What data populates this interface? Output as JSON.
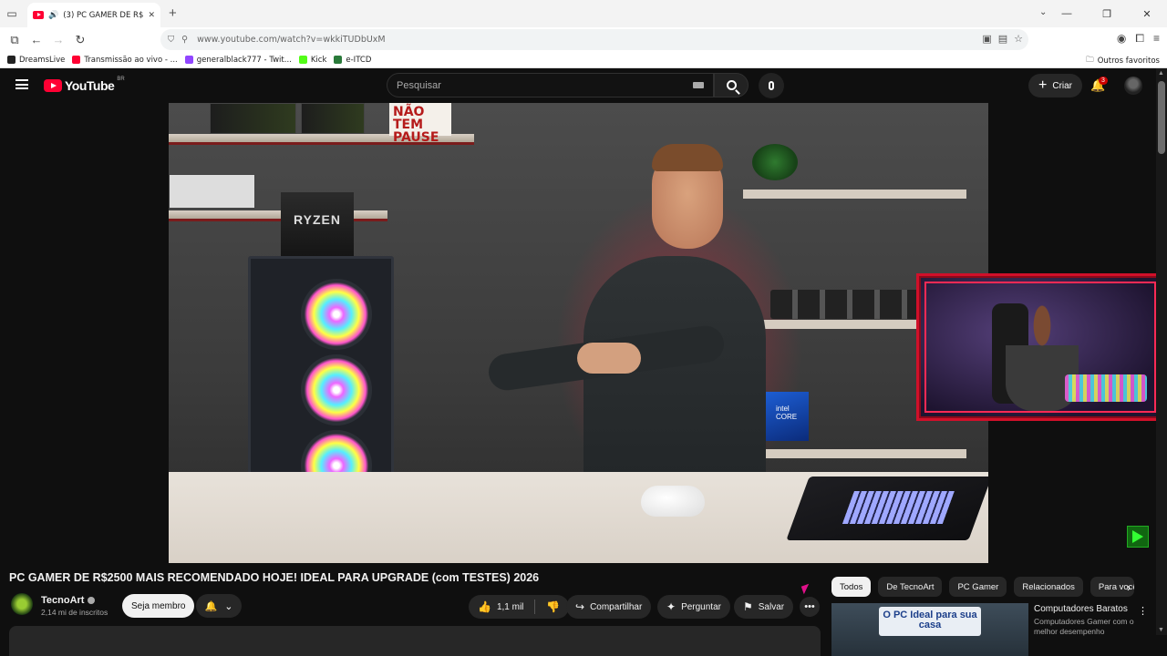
{
  "browser": {
    "tab_title": "(3) PC GAMER DE R$2500 M",
    "url": "www.youtube.com/watch?v=wkkiTUDbUxM",
    "bookmarks": [
      "DreamsLive",
      "Transmissão ao vivo - ...",
      "generalblack777 - Twit...",
      "Kick",
      "e-ITCD"
    ],
    "bookmarks_other": "Outros favoritos"
  },
  "youtube": {
    "logo_text": "YouTube",
    "region": "BR",
    "search_placeholder": "Pesquisar",
    "create_label": "Criar",
    "notification_count": "3"
  },
  "video": {
    "title": "PC GAMER DE R$2500 MAIS RECOMENDADO HOJE! IDEAL PARA UPGRADE (com TESTES) 2026",
    "overlay_sign": "NÃO TEM PAUSE",
    "ryzen_label": "RYZEN",
    "intel_label": "intel CORE"
  },
  "channel": {
    "name": "TecnoArt",
    "subscribers": "2,14 mi de inscritos",
    "member_button": "Seja membro"
  },
  "actions": {
    "likes": "1,1 mil",
    "share": "Compartilhar",
    "ask": "Perguntar",
    "save": "Salvar"
  },
  "filters": [
    "Todos",
    "De TecnoArt",
    "PC Gamer",
    "Relacionados",
    "Para você"
  ],
  "recommendation": {
    "title": "Computadores Baratos",
    "subtitle": "Computadores Gamer com o melhor desempenho",
    "thumb_text": "O PC Ideal para sua casa"
  },
  "colors": {
    "youtube_red": "#ff0033",
    "background": "#0f0f0f",
    "chip_bg": "#272727"
  }
}
